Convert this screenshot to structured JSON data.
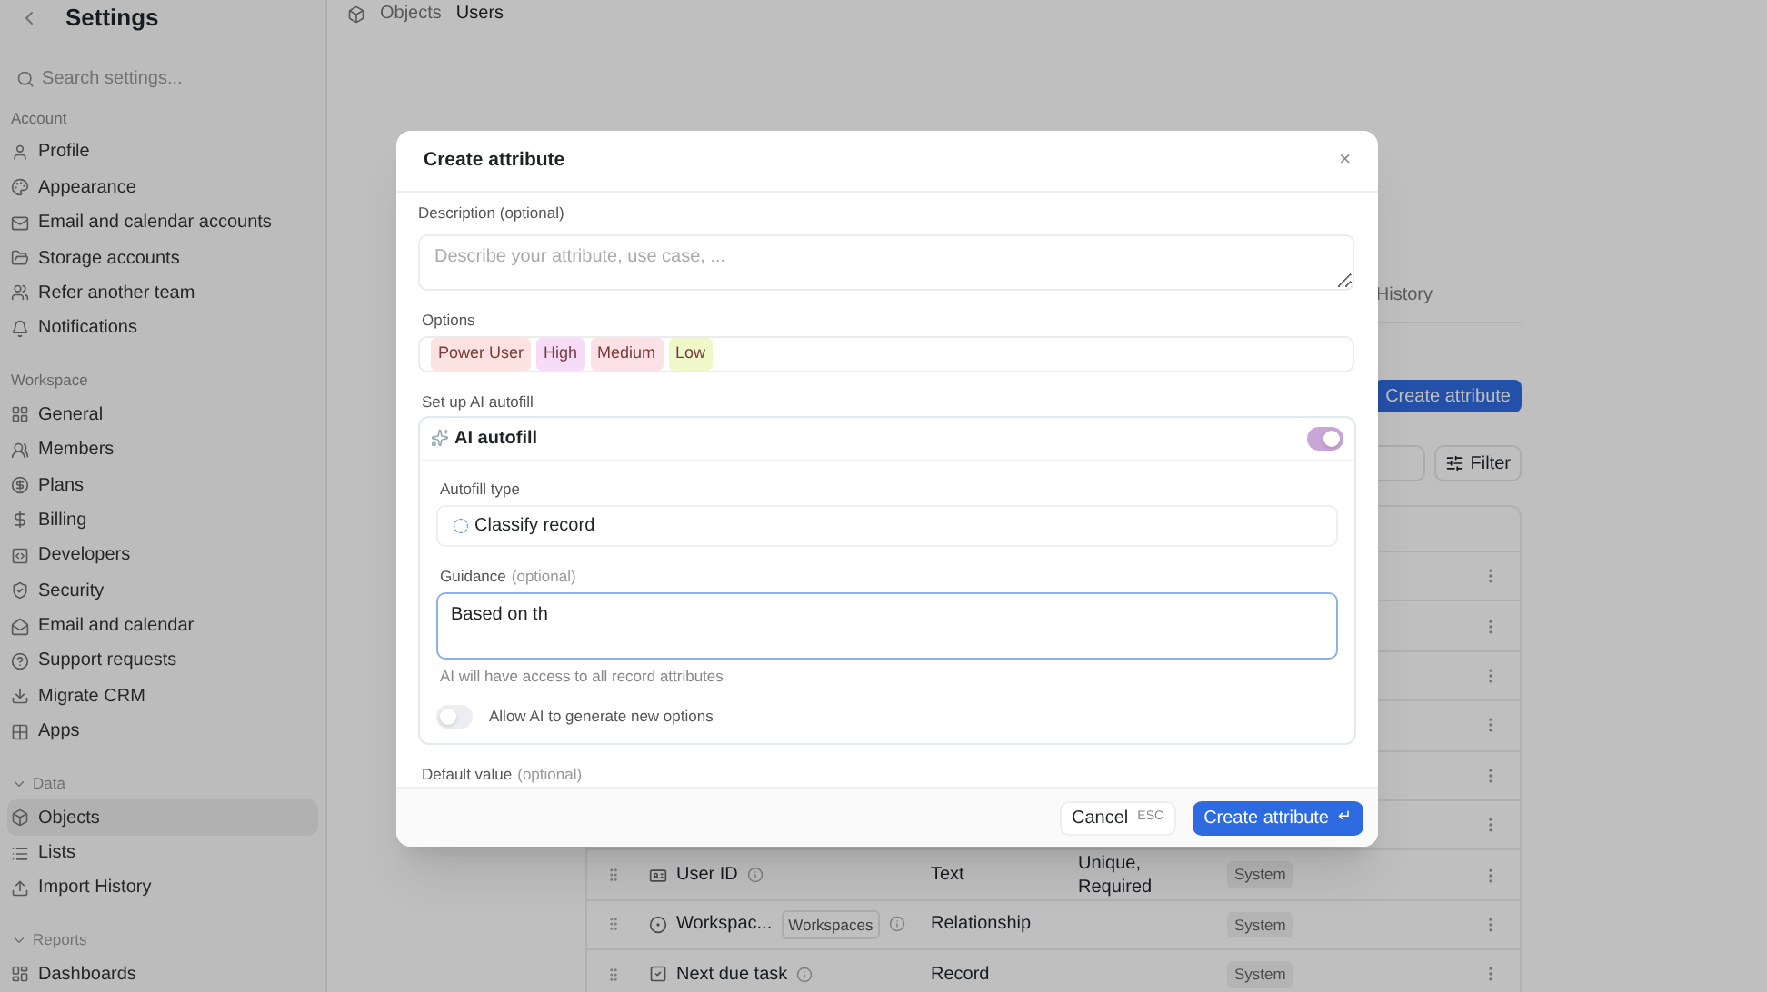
{
  "sidebar": {
    "title": "Settings",
    "search": {
      "placeholder": "Search settings..."
    },
    "sections": [
      {
        "label": "Account",
        "collapsible": false,
        "items": [
          {
            "label": "Profile",
            "selected": false
          },
          {
            "label": "Appearance",
            "selected": false
          },
          {
            "label": "Email and calendar accounts",
            "selected": false
          },
          {
            "label": "Storage accounts",
            "selected": false
          },
          {
            "label": "Refer another team",
            "selected": false
          },
          {
            "label": "Notifications",
            "selected": false
          }
        ]
      },
      {
        "label": "Workspace",
        "collapsible": false,
        "items": [
          {
            "label": "General",
            "selected": false
          },
          {
            "label": "Members",
            "selected": false
          },
          {
            "label": "Plans",
            "selected": false
          },
          {
            "label": "Billing",
            "selected": false
          },
          {
            "label": "Developers",
            "selected": false
          },
          {
            "label": "Security",
            "selected": false
          },
          {
            "label": "Email and calendar",
            "selected": false
          },
          {
            "label": "Support requests",
            "selected": false
          },
          {
            "label": "Migrate CRM",
            "selected": false
          },
          {
            "label": "Apps",
            "selected": false
          }
        ]
      },
      {
        "label": "Data",
        "collapsible": true,
        "items": [
          {
            "label": "Objects",
            "selected": true
          },
          {
            "label": "Lists",
            "selected": false
          },
          {
            "label": "Import History",
            "selected": false
          }
        ]
      },
      {
        "label": "Reports",
        "collapsible": true,
        "items": [
          {
            "label": "Dashboards",
            "selected": false
          }
        ]
      }
    ]
  },
  "breadcrumb": [
    "Objects",
    "Users"
  ],
  "tab": "History",
  "create_button": "Create attribute",
  "filter_button": "Filter",
  "table": {
    "rows": [
      {
        "name": "User ID",
        "tag": "",
        "type": "Text",
        "constraints": "Unique, Required",
        "badge": "System"
      },
      {
        "name": "Workspac...",
        "tag": "Workspaces",
        "type": "Relationship",
        "constraints": "",
        "badge": "System"
      },
      {
        "name": "Next due task",
        "tag": "",
        "type": "Record",
        "constraints": "",
        "badge": "System"
      }
    ]
  },
  "dialog": {
    "title": "Create attribute",
    "close": "×",
    "description": {
      "label": "Description (optional)",
      "placeholder": "Describe your attribute, use case, ..."
    },
    "options": {
      "label": "Options",
      "tags": [
        {
          "label": "Power User",
          "color": "#fde2e2"
        },
        {
          "label": "High",
          "color": "#f6dcf7"
        },
        {
          "label": "Medium",
          "color": "#fbe0e6"
        },
        {
          "label": "Low",
          "color": "#eef8c8"
        }
      ]
    },
    "autofill_label": "Set up AI autofill",
    "autofill": {
      "title": "AI autofill",
      "on": true,
      "type_label": "Autofill type",
      "type_value": "Classify record",
      "guidance_label": "Guidance",
      "guidance_hint": "(optional)",
      "guidance_value": "Based on th",
      "access_note": "AI will have access to all record attributes",
      "allow_new": {
        "label": "Allow AI to generate new options",
        "on": false
      }
    },
    "default_label": "Default value",
    "default_hint": "(optional)",
    "cancel": "Cancel",
    "cancel_key": "ESC",
    "submit": "Create attribute",
    "submit_key": "↵"
  }
}
